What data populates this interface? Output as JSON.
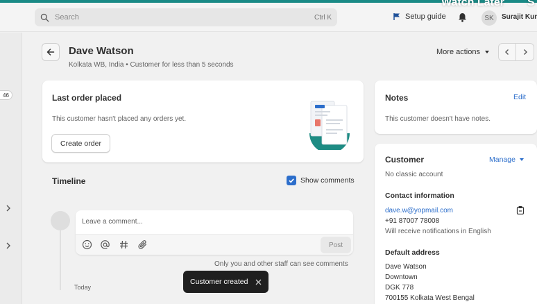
{
  "overlay": {
    "watch_later": "Watch Later",
    "corner_letter": "S"
  },
  "topbar": {
    "search_placeholder": "Search",
    "search_shortcut": "Ctrl K",
    "setup_guide": "Setup guide",
    "avatar_initials": "SK",
    "user_name": "Surajit Kun"
  },
  "sidebar": {
    "badge": "46"
  },
  "header": {
    "title": "Dave Watson",
    "subtitle": "Kolkata WB, India • Customer for less than 5 seconds",
    "more_actions": "More actions"
  },
  "last_order": {
    "title": "Last order placed",
    "message": "This customer hasn't placed any orders yet.",
    "button": "Create order"
  },
  "timeline": {
    "title": "Timeline",
    "show_comments": "Show comments",
    "comment_placeholder": "Leave a comment...",
    "post_button": "Post",
    "visibility_note": "Only you and other staff can see comments",
    "day_label": "Today"
  },
  "toast": {
    "message": "Customer created"
  },
  "notes": {
    "title": "Notes",
    "edit": "Edit",
    "message": "This customer doesn't have notes."
  },
  "customer": {
    "title": "Customer",
    "manage": "Manage",
    "account_status": "No classic account",
    "contact_heading": "Contact information",
    "email": "dave.w@yopmail.com",
    "phone": "+91 87007 78008",
    "notifications": "Will receive notifications in English",
    "address_heading": "Default address",
    "address_lines": [
      "Dave Watson",
      "Downtown",
      "DGK 778",
      "700155 Kolkata West Bengal"
    ]
  },
  "colors": {
    "accent": "#2c6ecb",
    "top_strip": "#1a8a86",
    "toast_bg": "#1f1f1f"
  }
}
